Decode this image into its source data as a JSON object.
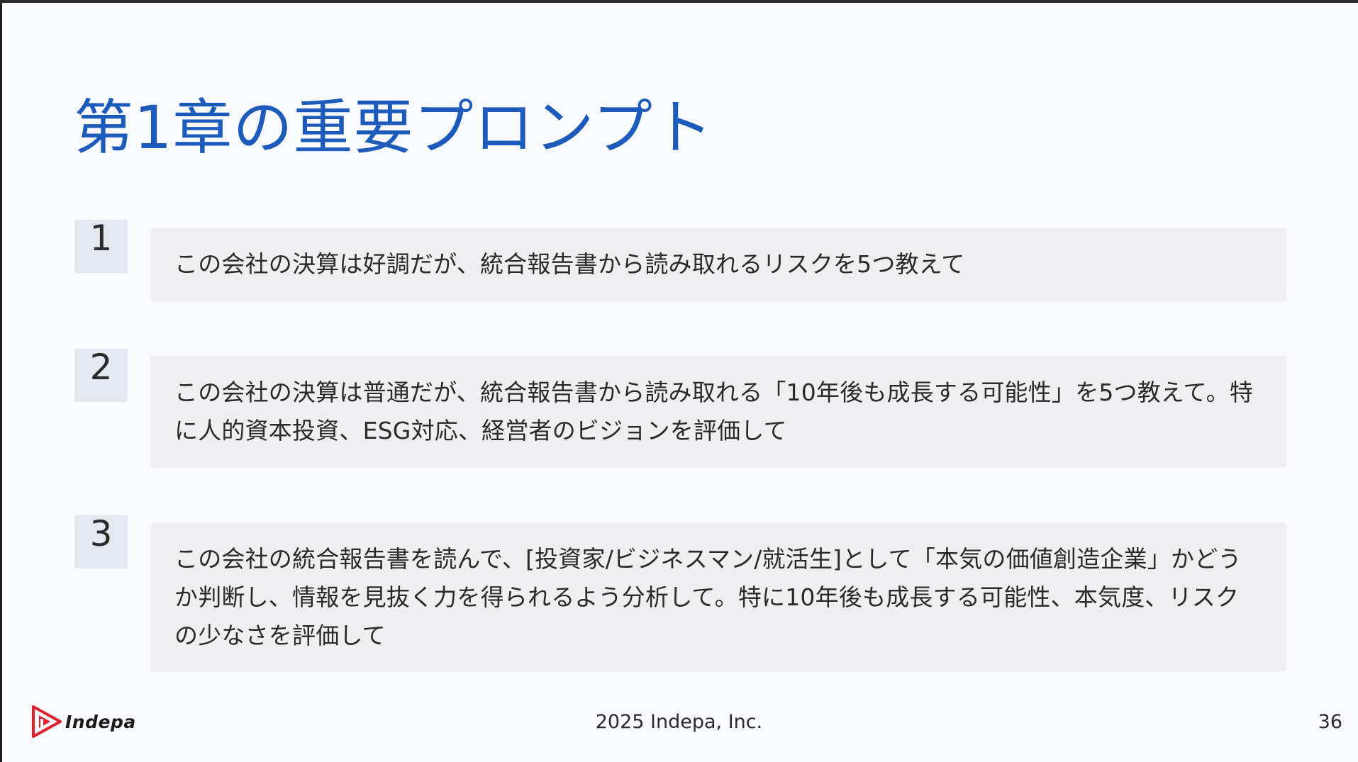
{
  "slide": {
    "title": "第1章の重要プロンプト",
    "prompts": [
      {
        "number": "1",
        "text": "この会社の決算は好調だが、統合報告書から読み取れるリスクを5つ教えて"
      },
      {
        "number": "2",
        "text": "この会社の決算は普通だが、統合報告書から読み取れる「10年後も成長する可能性」を5つ教えて。特に人的資本投資、ESG対応、経営者のビジョンを評価して"
      },
      {
        "number": "3",
        "text": "この会社の統合報告書を読んで、[投資家/ビジネスマン/就活生]として「本気の価値創造企業」かどうか判断し、情報を見抜く力を得られるよう分析して。特に10年後も成長する可能性、本気度、リスクの少なさを評価して"
      }
    ]
  },
  "footer": {
    "logo_text": "Indepa",
    "copyright": "2025 Indepa, Inc.",
    "page_number": "36"
  },
  "colors": {
    "title": "#1c5bbb",
    "badge_bg": "#e4e9f1",
    "card_bg": "#efeff1",
    "logo_red": "#e0202c",
    "slide_bg": "#f8fafd"
  }
}
